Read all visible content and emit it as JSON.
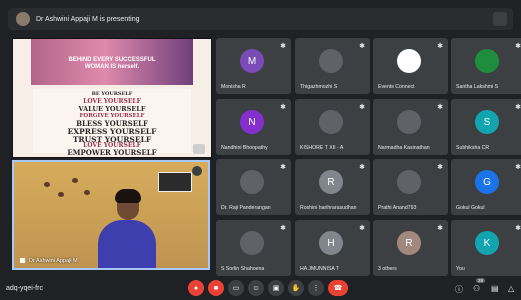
{
  "presenting_banner": {
    "text": "Dr Ashwini Appaji M is presenting"
  },
  "slide": {
    "title_line1": "BEHIND EVERY SUCCESSFUL",
    "title_line2": "WOMAN IS herself.",
    "lines": [
      "BE YOURSELF",
      "LOVE YOURSELF",
      "VALUE YOURSELF",
      "FORGIVE YOURSELF",
      "BLESS YOURSELF",
      "EXPRESS YOURSELF",
      "TRUST YOURSELF",
      "LOVE YOURSELF",
      "EMPOWER YOURSELF"
    ]
  },
  "presenter_tile": {
    "name": "Dr Ashwini Appaji M"
  },
  "participants": [
    {
      "label": "Monisha R",
      "initial": "M",
      "color": "#7b4bb7"
    },
    {
      "label": "Thigazhmozhi S",
      "initial": "",
      "color": "#5f6368"
    },
    {
      "label": "Events Connect",
      "initial": "",
      "color": "#ffffff"
    },
    {
      "label": "Santha Lakshmi S",
      "initial": "",
      "color": "#1e8e3e"
    },
    {
      "label": "Nandhini Bhoopathy",
      "initial": "N",
      "color": "#8430ce"
    },
    {
      "label": "KISHORE T XII - A",
      "initial": "",
      "color": "#5f6368"
    },
    {
      "label": "Narmadha Kasinathan",
      "initial": "",
      "color": "#5f6368"
    },
    {
      "label": "Subhiksha CR",
      "initial": "S",
      "color": "#12a4af"
    },
    {
      "label": "Dr. Raji Panderangan",
      "initial": "",
      "color": "#5f6368"
    },
    {
      "label": "Roshini harihrarasudhan",
      "initial": "R",
      "color": "#80868b"
    },
    {
      "label": "Prathi Anand793",
      "initial": "",
      "color": "#5f6368"
    },
    {
      "label": "Gokul Gokul",
      "initial": "G",
      "color": "#1a73e8"
    },
    {
      "label": "S Sorlin Shahoena",
      "initial": "",
      "color": "#5f6368"
    },
    {
      "label": "HA JMUNNISA T",
      "initial": "H",
      "color": "#80868b"
    },
    {
      "label": "3 others",
      "initial": "R",
      "color": "#a1887f"
    },
    {
      "label": "You",
      "initial": "K",
      "color": "#12a4af"
    }
  ],
  "meeting_code": "adq-yqei-frc",
  "controls": [
    "mic-off",
    "camera-off",
    "captions",
    "emoji",
    "present",
    "raise-hand",
    "more",
    "end-call"
  ],
  "side_controls": [
    "info",
    "people",
    "chat",
    "activities"
  ],
  "people_badge": "28",
  "mic_icon": "✱",
  "colors": {
    "background": "#202124",
    "tile": "#3c4043",
    "end_call": "#ea4335",
    "accent": "#a8c7fa"
  }
}
